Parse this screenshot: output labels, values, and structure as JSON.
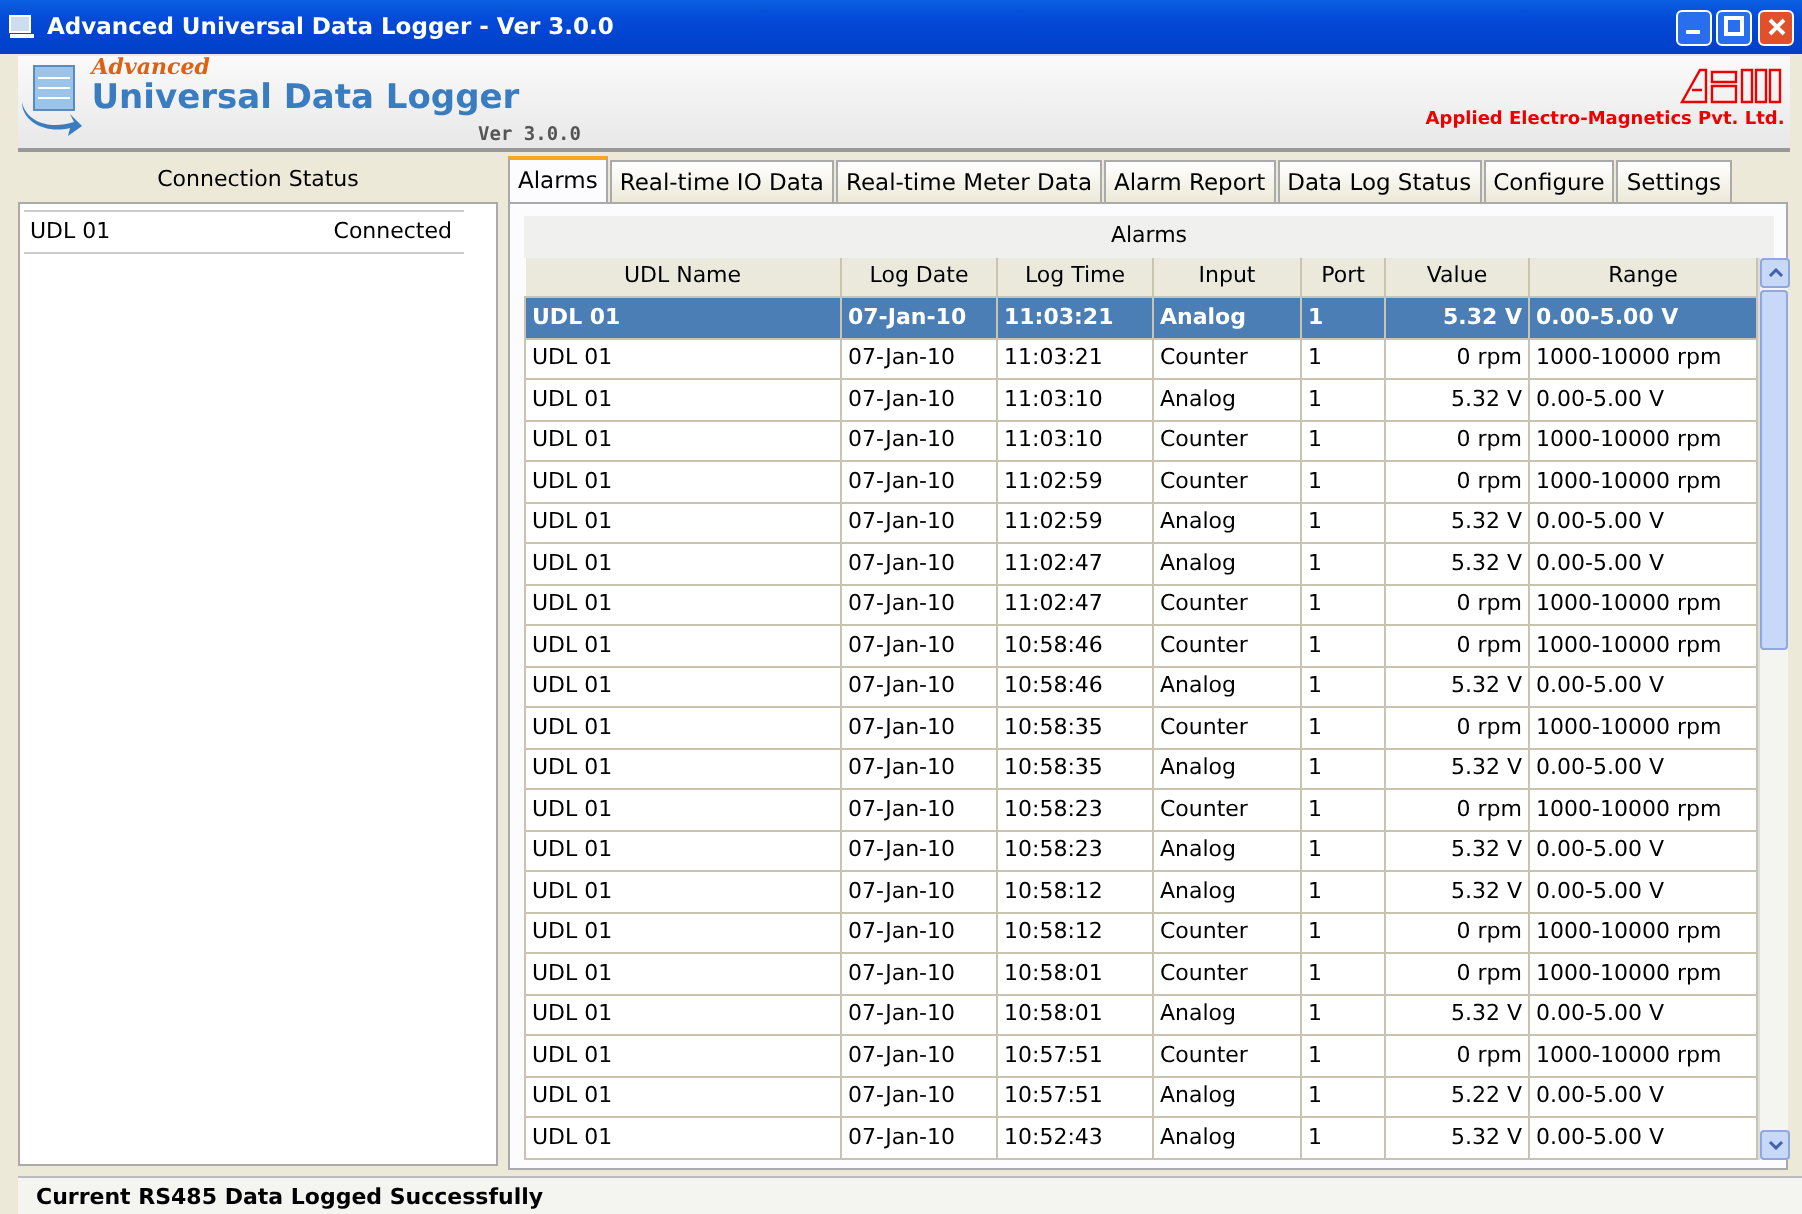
{
  "window": {
    "title": "Advanced Universal Data Logger - Ver 3.0.0"
  },
  "banner": {
    "tagline": "Advanced",
    "product": "Universal Data Logger",
    "version": "Ver 3.0.0",
    "company": "Applied Electro-Magnetics Pvt. Ltd."
  },
  "connection_status": {
    "title": "Connection Status",
    "rows": [
      {
        "name": "UDL 01",
        "status": "Connected"
      }
    ]
  },
  "tabs": [
    {
      "label": "Alarms",
      "selected": true
    },
    {
      "label": "Real-time IO Data",
      "selected": false
    },
    {
      "label": "Real-time Meter Data",
      "selected": false
    },
    {
      "label": "Alarm Report",
      "selected": false
    },
    {
      "label": "Data Log Status",
      "selected": false
    },
    {
      "label": "Configure",
      "selected": false
    },
    {
      "label": "Settings",
      "selected": false
    }
  ],
  "alarms": {
    "title": "Alarms",
    "columns": [
      "UDL Name",
      "Log Date",
      "Log Time",
      "Input",
      "Port",
      "Value",
      "Range"
    ],
    "rows": [
      {
        "cells": [
          "UDL 01",
          "07-Jan-10",
          "11:03:21",
          "Analog",
          "1",
          "5.32 V",
          "0.00-5.00 V"
        ],
        "selected": true
      },
      {
        "cells": [
          "UDL 01",
          "07-Jan-10",
          "11:03:21",
          "Counter",
          "1",
          "0 rpm",
          "1000-10000 rpm"
        ],
        "selected": false
      },
      {
        "cells": [
          "UDL 01",
          "07-Jan-10",
          "11:03:10",
          "Analog",
          "1",
          "5.32 V",
          "0.00-5.00 V"
        ],
        "selected": false
      },
      {
        "cells": [
          "UDL 01",
          "07-Jan-10",
          "11:03:10",
          "Counter",
          "1",
          "0 rpm",
          "1000-10000 rpm"
        ],
        "selected": false
      },
      {
        "cells": [
          "UDL 01",
          "07-Jan-10",
          "11:02:59",
          "Counter",
          "1",
          "0 rpm",
          "1000-10000 rpm"
        ],
        "selected": false
      },
      {
        "cells": [
          "UDL 01",
          "07-Jan-10",
          "11:02:59",
          "Analog",
          "1",
          "5.32 V",
          "0.00-5.00 V"
        ],
        "selected": false
      },
      {
        "cells": [
          "UDL 01",
          "07-Jan-10",
          "11:02:47",
          "Analog",
          "1",
          "5.32 V",
          "0.00-5.00 V"
        ],
        "selected": false
      },
      {
        "cells": [
          "UDL 01",
          "07-Jan-10",
          "11:02:47",
          "Counter",
          "1",
          "0 rpm",
          "1000-10000 rpm"
        ],
        "selected": false
      },
      {
        "cells": [
          "UDL 01",
          "07-Jan-10",
          "10:58:46",
          "Counter",
          "1",
          "0 rpm",
          "1000-10000 rpm"
        ],
        "selected": false
      },
      {
        "cells": [
          "UDL 01",
          "07-Jan-10",
          "10:58:46",
          "Analog",
          "1",
          "5.32 V",
          "0.00-5.00 V"
        ],
        "selected": false
      },
      {
        "cells": [
          "UDL 01",
          "07-Jan-10",
          "10:58:35",
          "Counter",
          "1",
          "0 rpm",
          "1000-10000 rpm"
        ],
        "selected": false
      },
      {
        "cells": [
          "UDL 01",
          "07-Jan-10",
          "10:58:35",
          "Analog",
          "1",
          "5.32 V",
          "0.00-5.00 V"
        ],
        "selected": false
      },
      {
        "cells": [
          "UDL 01",
          "07-Jan-10",
          "10:58:23",
          "Counter",
          "1",
          "0 rpm",
          "1000-10000 rpm"
        ],
        "selected": false
      },
      {
        "cells": [
          "UDL 01",
          "07-Jan-10",
          "10:58:23",
          "Analog",
          "1",
          "5.32 V",
          "0.00-5.00 V"
        ],
        "selected": false
      },
      {
        "cells": [
          "UDL 01",
          "07-Jan-10",
          "10:58:12",
          "Analog",
          "1",
          "5.32 V",
          "0.00-5.00 V"
        ],
        "selected": false
      },
      {
        "cells": [
          "UDL 01",
          "07-Jan-10",
          "10:58:12",
          "Counter",
          "1",
          "0 rpm",
          "1000-10000 rpm"
        ],
        "selected": false
      },
      {
        "cells": [
          "UDL 01",
          "07-Jan-10",
          "10:58:01",
          "Counter",
          "1",
          "0 rpm",
          "1000-10000 rpm"
        ],
        "selected": false
      },
      {
        "cells": [
          "UDL 01",
          "07-Jan-10",
          "10:58:01",
          "Analog",
          "1",
          "5.32 V",
          "0.00-5.00 V"
        ],
        "selected": false
      },
      {
        "cells": [
          "UDL 01",
          "07-Jan-10",
          "10:57:51",
          "Counter",
          "1",
          "0 rpm",
          "1000-10000 rpm"
        ],
        "selected": false
      },
      {
        "cells": [
          "UDL 01",
          "07-Jan-10",
          "10:57:51",
          "Analog",
          "1",
          "5.22 V",
          "0.00-5.00 V"
        ],
        "selected": false
      },
      {
        "cells": [
          "UDL 01",
          "07-Jan-10",
          "10:52:43",
          "Analog",
          "1",
          "5.32 V",
          "0.00-5.00 V"
        ],
        "selected": false
      }
    ]
  },
  "status_bar": {
    "message": "Current RS485 Data Logged Successfully"
  }
}
